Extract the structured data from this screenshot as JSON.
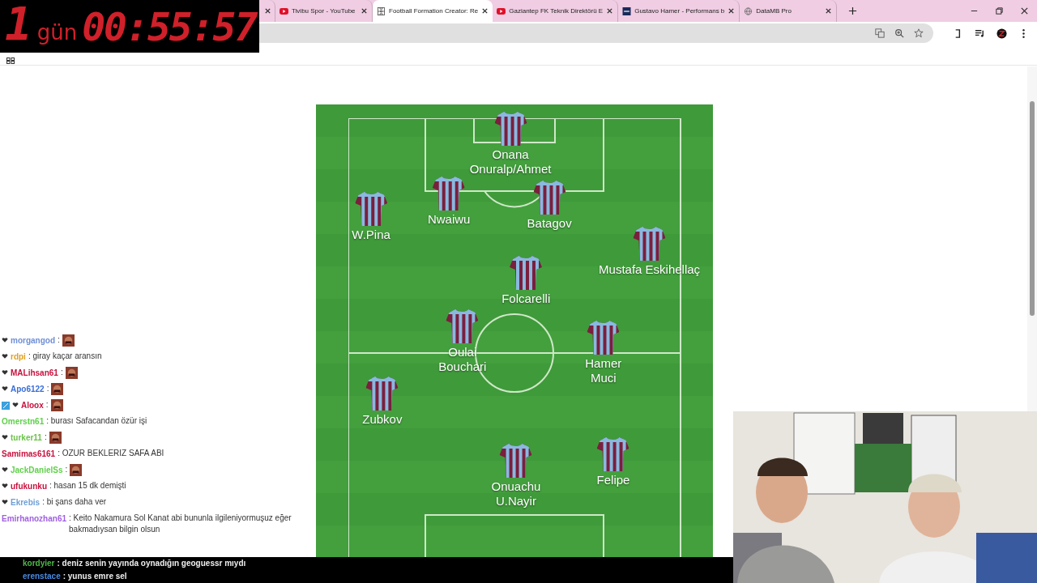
{
  "timer": {
    "days": "1",
    "unit": "gün",
    "clock": "00:55:57"
  },
  "tabs": [
    {
      "selected": false,
      "kind": "blank"
    },
    {
      "title": "Tivibu Spor - YouTube",
      "selected": false,
      "kind": "video"
    },
    {
      "title": "Football Formation Creator: Re",
      "selected": true,
      "kind": "pitch"
    },
    {
      "title": "Gaziantep FK Teknik Direktörü E",
      "selected": false,
      "kind": "video"
    },
    {
      "title": "Gustavo Hamer - Performans b",
      "selected": false,
      "kind": "site"
    },
    {
      "title": "DataMB Pro",
      "selected": false,
      "kind": "globe"
    }
  ],
  "players": [
    {
      "names": [
        "Onana",
        "Onuralp/Ahmet"
      ]
    },
    {
      "names": [
        "Nwaiwu"
      ]
    },
    {
      "names": [
        "Batagov"
      ]
    },
    {
      "names": [
        "W.Pina"
      ]
    },
    {
      "names": [
        "Mustafa Eskihellaç"
      ]
    },
    {
      "names": [
        "Folcarelli"
      ]
    },
    {
      "names": [
        "Oulai",
        "Bouchari"
      ]
    },
    {
      "names": [
        "Hamer",
        "Muci"
      ]
    },
    {
      "names": [
        "Zubkov"
      ]
    },
    {
      "names": [
        "Onuachu",
        "U.Nayir"
      ]
    },
    {
      "names": [
        "Felipe"
      ]
    }
  ],
  "chat": [
    {
      "user": "morgangod",
      "color": "#6f8fd6",
      "message": ":",
      "emote": true,
      "badge": false,
      "heart": true
    },
    {
      "user": "rdpi",
      "color": "#e0a020",
      "message": ": giray kaçar aransın",
      "emote": false,
      "badge": false,
      "heart": true
    },
    {
      "user": "MALihsan61",
      "color": "#c8103c",
      "message": ":",
      "emote": true,
      "badge": false,
      "heart": true
    },
    {
      "user": "Apo6122",
      "color": "#3a6fd8",
      "message": ":",
      "emote": true,
      "badge": false,
      "heart": true
    },
    {
      "user": "Aloox",
      "color": "#c8103c",
      "message": ":",
      "emote": true,
      "badge": true,
      "heart": true
    },
    {
      "user": "Omerstn61",
      "color": "#5fd04a",
      "message": ": burası Safacandan özür işi",
      "emote": false,
      "badge": false,
      "heart": false
    },
    {
      "user": "turker11",
      "color": "#6cc24a",
      "message": ":",
      "emote": true,
      "badge": false,
      "heart": true
    },
    {
      "user": "Samimas6161",
      "color": "#c8103c",
      "message": ": OZUR BEKLERIZ SAFA ABI",
      "emote": false,
      "badge": false,
      "heart": false
    },
    {
      "user": "JackDanielSs",
      "color": "#5fd04a",
      "message": ":",
      "emote": true,
      "badge": false,
      "heart": true
    },
    {
      "user": "ufukunku",
      "color": "#c8103c",
      "message": ": hasan 15 dk demişti",
      "emote": false,
      "badge": false,
      "heart": true
    },
    {
      "user": "Ekrebis",
      "color": "#6f9fd6",
      "message": ": bi şans daha ver",
      "emote": false,
      "badge": false,
      "heart": true
    },
    {
      "user": "Emirhanozhan61",
      "color": "#a060e0",
      "message": ": Keito Nakamura Sol Kanat abi bununla ilgileniyormuşuz eğer bakmadıysan bilgin olsun",
      "emote": false,
      "badge": false,
      "heart": false
    }
  ],
  "live_chat": [
    {
      "user": "kordyier",
      "color": "#4fb84a",
      "message": ": deniz senin yayında oynadığın geoguessr mıydı"
    },
    {
      "user": "erenstace",
      "color": "#4a8ae0",
      "message": ": yunus emre sel"
    }
  ]
}
